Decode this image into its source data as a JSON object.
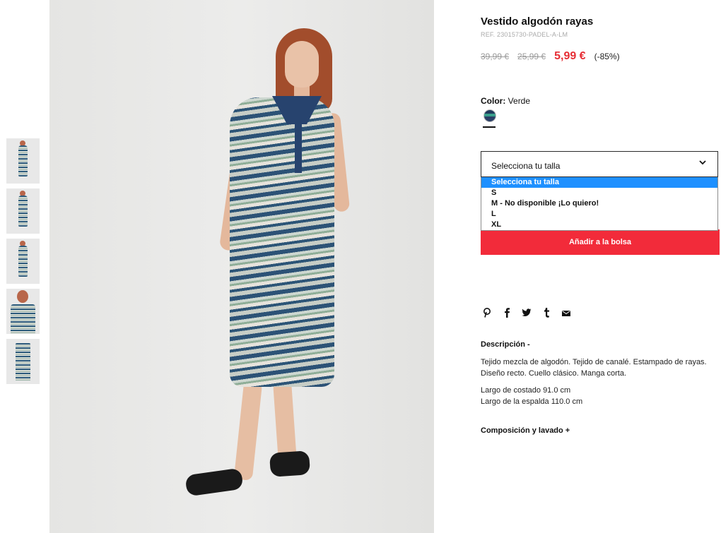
{
  "product": {
    "title": "Vestido algodón rayas",
    "ref": "REF. 23015730-PADEL-A-LM",
    "price_old_1": "39,99 €",
    "price_old_2": "25,99 €",
    "price_now": "5,99 €",
    "discount": "(-85%)"
  },
  "color": {
    "label": "Color:",
    "value": "Verde"
  },
  "size_select": {
    "selected": "Selecciona tu talla",
    "options": [
      "Selecciona tu talla",
      "S",
      "M - No disponible ¡Lo quiero!",
      "L",
      "XL"
    ]
  },
  "add_button": "Añadir a la bolsa",
  "share_icons": [
    "pinterest-icon",
    "facebook-icon",
    "twitter-icon",
    "tumblr-icon",
    "email-icon"
  ],
  "description": {
    "heading": "Descripción -",
    "text": "Tejido mezcla de algodón. Tejido de canalé. Estampado de rayas. Diseño recto. Cuello clásico. Manga corta.",
    "dim1": "Largo de costado 91.0 cm",
    "dim2": "Largo de la espalda 110.0 cm"
  },
  "composition_heading": "Composición y lavado +",
  "colors": {
    "accent_red": "#f22b3a",
    "price_red": "#e62e35",
    "select_highlight": "#1e90ff"
  }
}
